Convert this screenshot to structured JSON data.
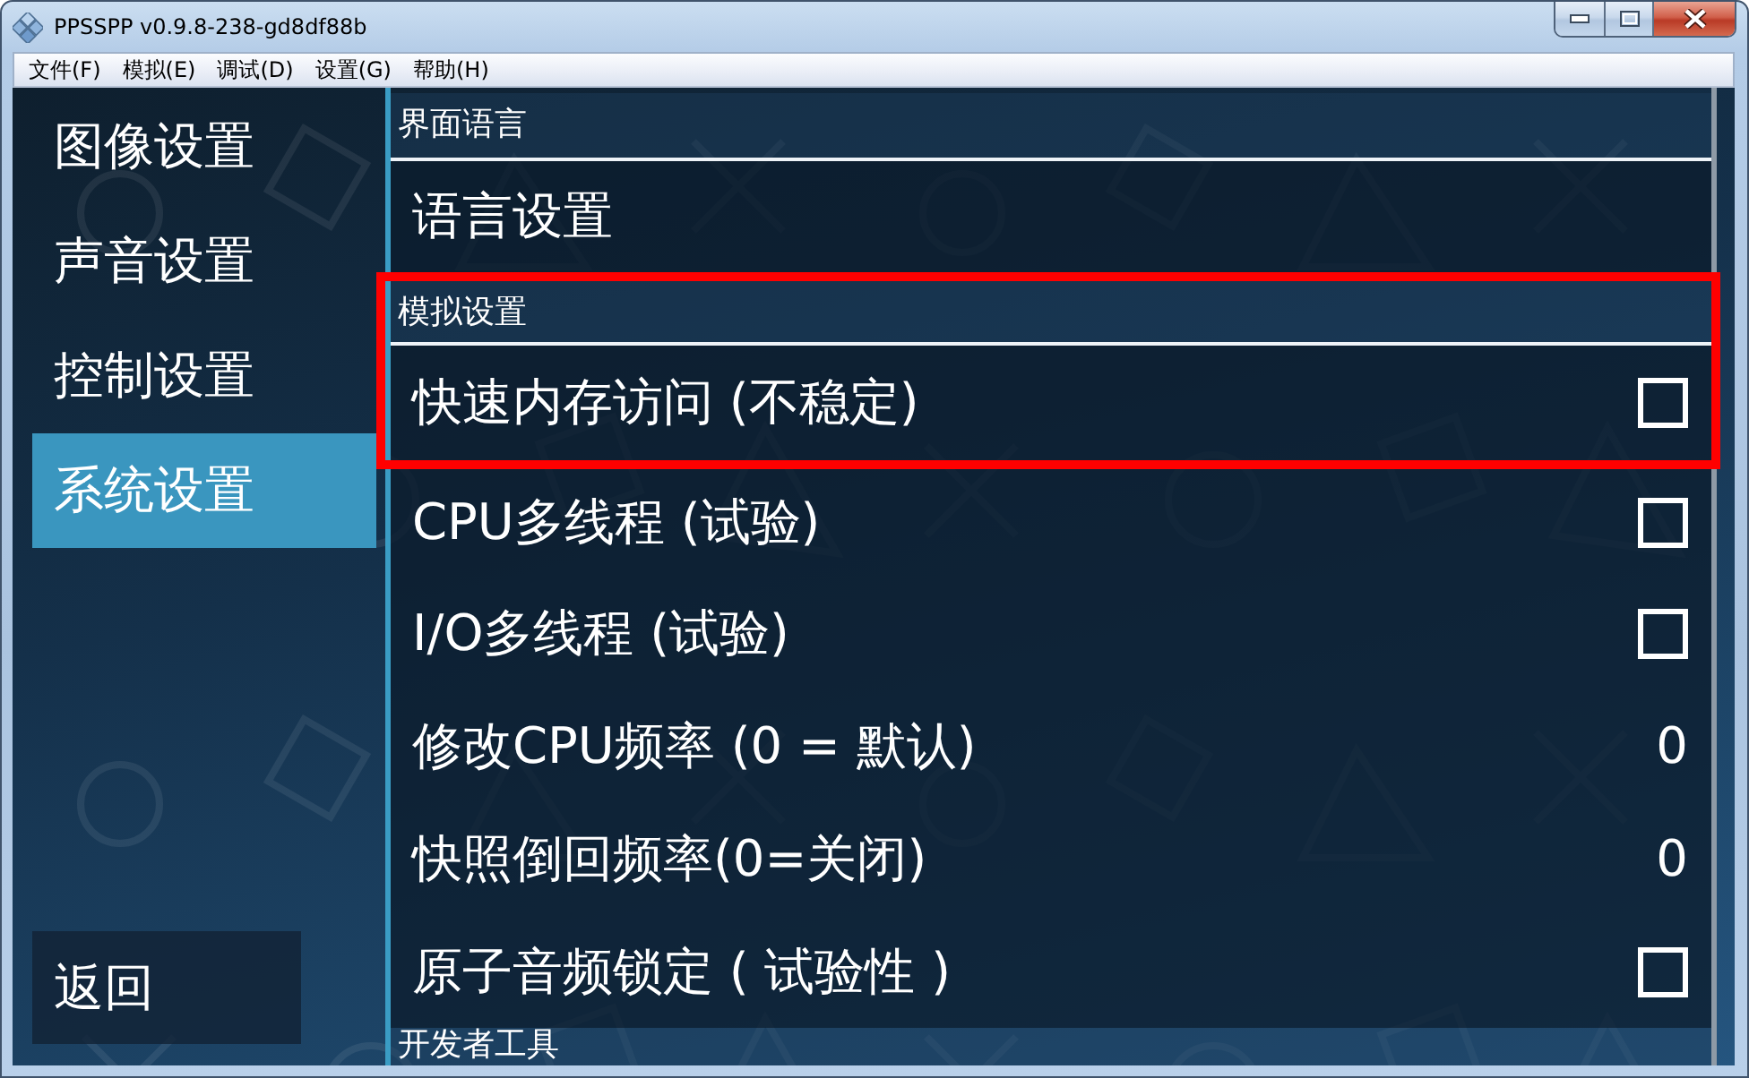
{
  "window": {
    "title": "PPSSPP v0.9.8-238-gd8df88b"
  },
  "menu_bar": [
    "文件(F)",
    "模拟(E)",
    "调试(D)",
    "设置(G)",
    "帮助(H)"
  ],
  "sidebar": {
    "items": [
      {
        "label": "图像设置",
        "selected": false
      },
      {
        "label": "声音设置",
        "selected": false
      },
      {
        "label": "控制设置",
        "selected": false
      },
      {
        "label": "系统设置",
        "selected": true
      }
    ],
    "back_button": "返回"
  },
  "settings": {
    "sections": [
      {
        "title": "界面语言",
        "highlighted": false,
        "items": [
          {
            "kind": "link",
            "label": "语言设置"
          }
        ]
      },
      {
        "title": "模拟设置",
        "highlighted": true,
        "items": [
          {
            "kind": "checkbox",
            "label": "快速内存访问 (不稳定)",
            "checked": false
          },
          {
            "kind": "checkbox",
            "label": "CPU多线程 (试验)",
            "checked": false
          },
          {
            "kind": "checkbox",
            "label": "I/O多线程 (试验)",
            "checked": false
          },
          {
            "kind": "value",
            "label": "修改CPU频率 (0 = 默认)",
            "value": "0"
          },
          {
            "kind": "value",
            "label": "快照倒回频率(0=关闭)",
            "value": "0"
          },
          {
            "kind": "checkbox",
            "label": "原子音频锁定 ( 试验性 )",
            "checked": false
          }
        ]
      },
      {
        "title": "开发者工具",
        "highlighted": false
      }
    ]
  }
}
